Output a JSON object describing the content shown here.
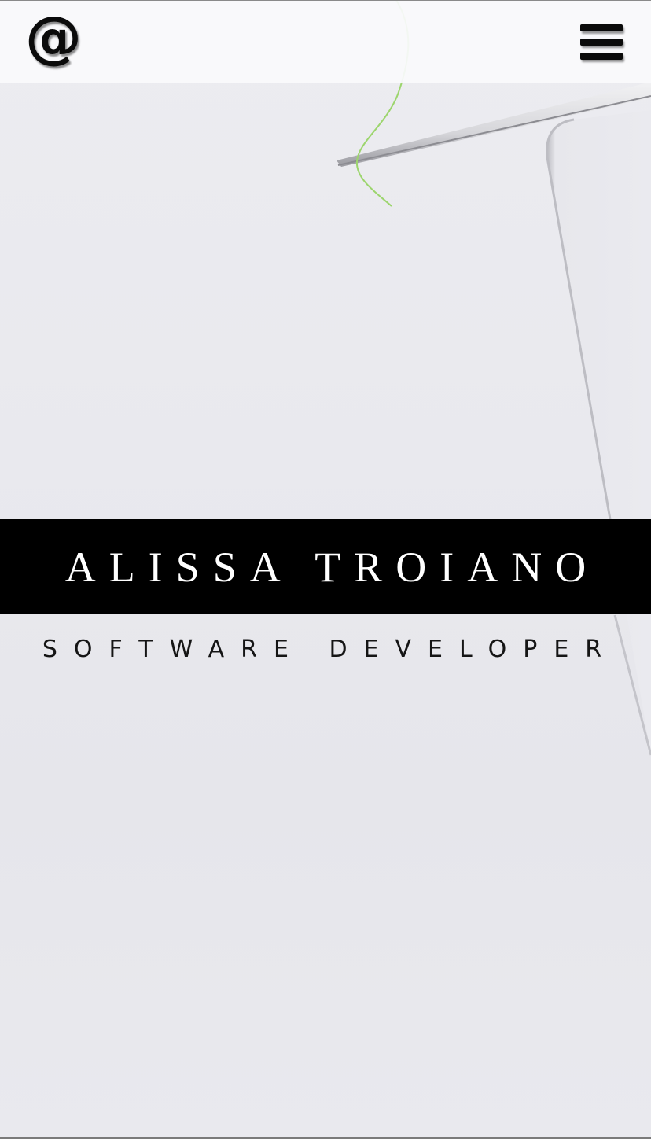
{
  "header": {
    "contact_icon": "@",
    "menu_icon": "hamburger-menu-icon"
  },
  "hero": {
    "name": "ALISSA TROIANO",
    "subtitle": "SOFTWARE DEVELOPER"
  },
  "colors": {
    "background": "#e9e9ee",
    "band": "#000000",
    "band_text": "#ffffff",
    "subtitle_text": "#151515",
    "header_bg": "#fafafc"
  }
}
